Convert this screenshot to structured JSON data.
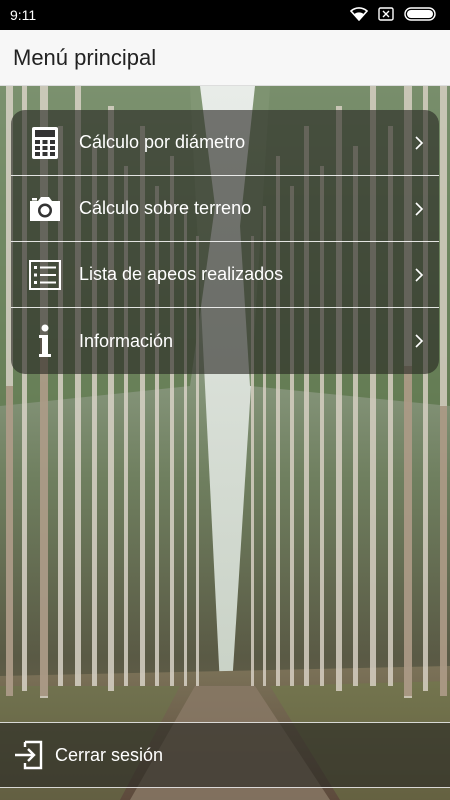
{
  "status_bar": {
    "time": "9:11"
  },
  "app_bar": {
    "title": "Menú principal"
  },
  "menu": {
    "items": [
      {
        "label": "Cálculo por diámetro",
        "icon": "calculator-icon"
      },
      {
        "label": "Cálculo sobre terreno",
        "icon": "camera-icon"
      },
      {
        "label": "Lista de apeos realizados",
        "icon": "list-icon"
      },
      {
        "label": "Información",
        "icon": "info-icon"
      }
    ]
  },
  "logout": {
    "label": "Cerrar sesión",
    "icon": "logout-icon"
  },
  "colors": {
    "app_bar_bg": "#f7f7f7",
    "overlay": "rgba(40,40,35,0.62)",
    "text": "#ffffff"
  }
}
